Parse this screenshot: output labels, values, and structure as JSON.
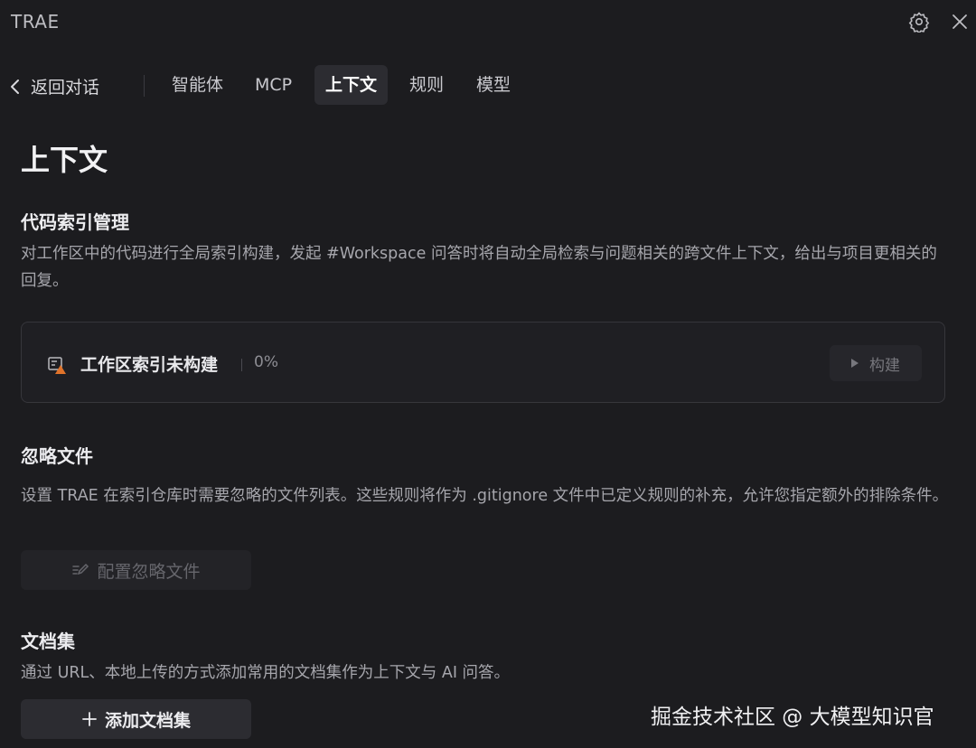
{
  "app": {
    "title": "TRAE"
  },
  "header": {
    "settings_icon": "gear-icon",
    "close_icon": "close-icon"
  },
  "nav": {
    "back_label": "返回对话",
    "tabs": [
      {
        "label": "智能体",
        "active": false
      },
      {
        "label": "MCP",
        "active": false
      },
      {
        "label": "上下文",
        "active": true
      },
      {
        "label": "规则",
        "active": false
      },
      {
        "label": "模型",
        "active": false
      }
    ]
  },
  "page": {
    "title": "上下文"
  },
  "code_index": {
    "title": "代码索引管理",
    "description": "对工作区中的代码进行全局索引构建，发起 #Workspace 问答时将自动全局检索与问题相关的跨文件上下文，给出与项目更相关的回复。",
    "status_label": "工作区索引未构建",
    "progress_text": "0%",
    "progress": 0,
    "build_button": "构建",
    "status_icon": "index-warning-icon"
  },
  "ignore_files": {
    "title": "忽略文件",
    "description": "设置 TRAE 在索引仓库时需要忽略的文件列表。这些规则将作为 .gitignore 文件中已定义规则的补充，允许您指定额外的排除条件。",
    "button_label": "配置忽略文件",
    "button_icon": "edit-list-icon"
  },
  "docs": {
    "title": "文档集",
    "description": "通过 URL、本地上传的方式添加常用的文档集作为上下文与 AI 问答。",
    "button_label": "添加文档集",
    "button_icon": "plus-icon"
  },
  "watermark": {
    "text": "掘金技术社区 @ 大模型知识官"
  },
  "colors": {
    "background": "#1c1c1f",
    "warning": "#e0732a",
    "active_tab": "#2c2c31"
  }
}
